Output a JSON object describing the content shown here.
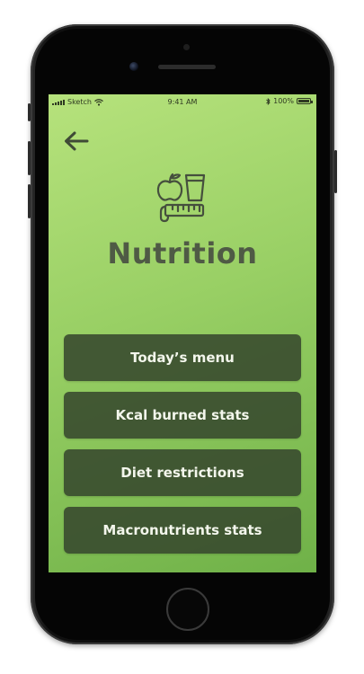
{
  "status_bar": {
    "carrier": "Sketch",
    "time": "9:41 AM",
    "battery": "100%"
  },
  "header": {
    "back_icon": "arrow-left-icon",
    "hero_icon": "nutrition-apple-glass-tape-icon"
  },
  "page": {
    "title": "Nutrition"
  },
  "menu": {
    "items": [
      {
        "label": "Today’s menu"
      },
      {
        "label": "Kcal burned stats"
      },
      {
        "label": "Diet restrictions"
      },
      {
        "label": "Macronutrients stats"
      }
    ]
  },
  "colors": {
    "background_top": "#b6e27c",
    "background_bottom": "#6fb148",
    "button": "#37482e",
    "title": "#4f5a45"
  }
}
